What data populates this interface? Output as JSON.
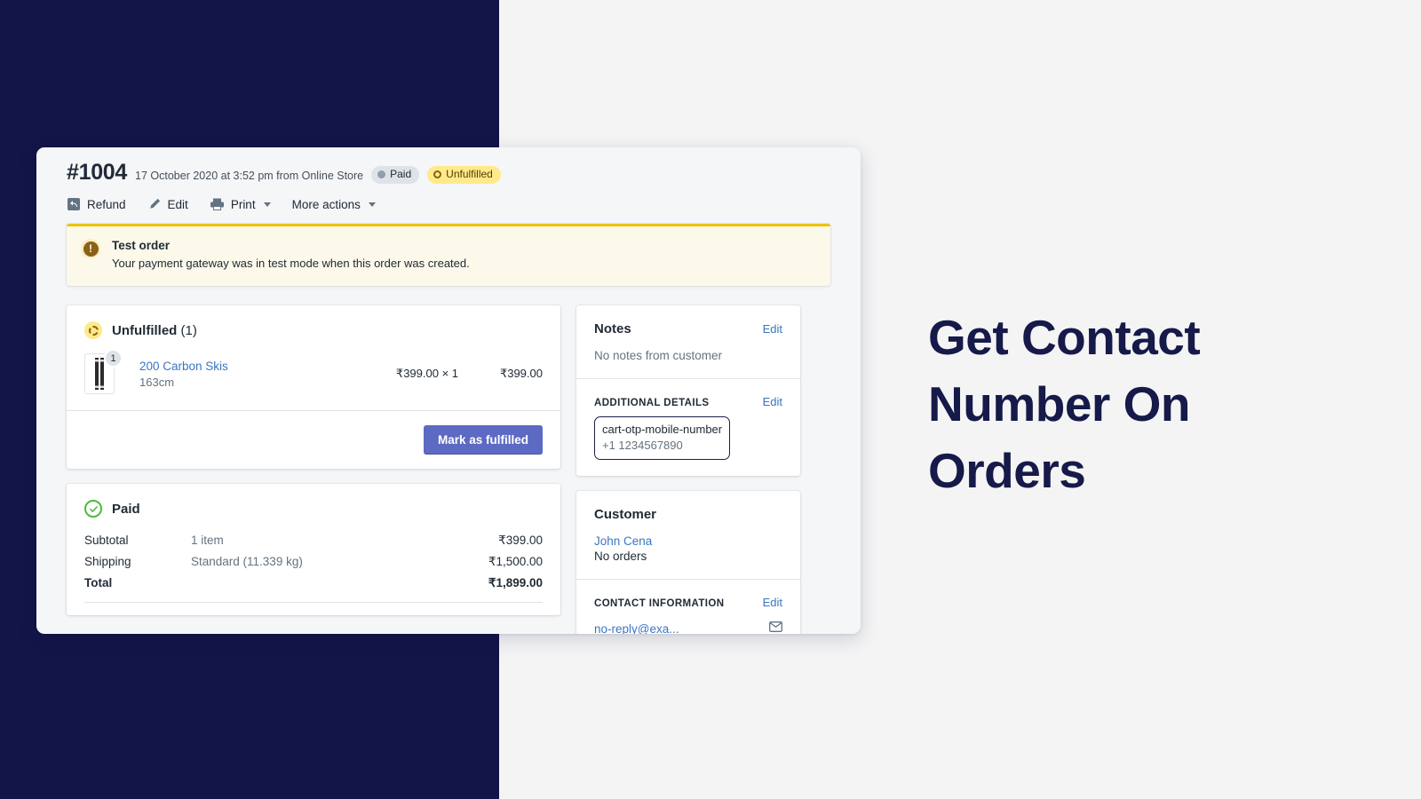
{
  "marketing": {
    "headline": "Get Contact Number On Orders",
    "navy_color": "#131447",
    "background_color": "#f4f4f5"
  },
  "order": {
    "number": "#1004",
    "meta": "17 October 2020 at 3:52 pm from Online Store",
    "badges": [
      {
        "label": "Paid",
        "type": "paid",
        "color": "#dfe3e8"
      },
      {
        "label": "Unfulfilled",
        "type": "unfulfilled",
        "color": "#ffea8a"
      }
    ]
  },
  "toolbar": {
    "refund_label": "Refund",
    "edit_label": "Edit",
    "print_label": "Print",
    "more_actions_label": "More actions"
  },
  "banner": {
    "icon": "alert-exclamation-icon",
    "title": "Test order",
    "text": "Your payment gateway was in test mode when this order was created.",
    "accent_color": "#eec200",
    "background_color": "#fcf8ea"
  },
  "fulfillment_card": {
    "status_label": "Unfulfilled",
    "count_label": "(1)",
    "line_item": {
      "name": "200 Carbon Skis",
      "variant": "163cm",
      "quantity_badge": "1",
      "unit_price": "₹399.00 × 1",
      "line_total": "₹399.00"
    },
    "primary_button": "Mark as fulfilled"
  },
  "payment_card": {
    "status_label": "Paid",
    "rows": [
      {
        "label": "Subtotal",
        "description": "1 item",
        "amount": "₹399.00",
        "bold": false
      },
      {
        "label": "Shipping",
        "description": "Standard (11.339 kg)",
        "amount": "₹1,500.00",
        "bold": false
      },
      {
        "label": "Total",
        "description": "",
        "amount": "₹1,899.00",
        "bold": true
      }
    ]
  },
  "notes_card": {
    "title": "Notes",
    "edit_label": "Edit",
    "empty_text": "No notes from customer",
    "additional_details": {
      "heading": "ADDITIONAL DETAILS",
      "edit_label": "Edit",
      "key": "cart-otp-mobile-number",
      "value": "+1 1234567890",
      "highlight_color": "#1a1f4b"
    }
  },
  "customer_card": {
    "title": "Customer",
    "name": "John Cena",
    "orders_text": "No orders",
    "contact_heading": "CONTACT INFORMATION",
    "contact_edit_label": "Edit",
    "contact_email": "no-reply@exa..."
  }
}
